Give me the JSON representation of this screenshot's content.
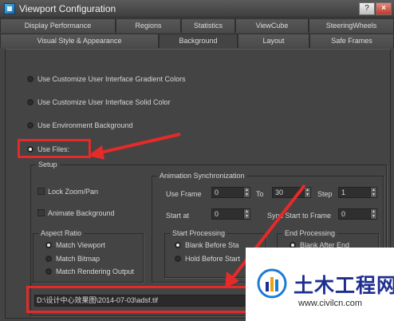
{
  "window": {
    "title": "Viewport Configuration",
    "help_label": "?",
    "close_label": "×"
  },
  "tabs_row1": [
    "Display Performance",
    "Regions",
    "Statistics",
    "ViewCube",
    "SteeringWheels"
  ],
  "tabs_row2": [
    "Visual Style & Appearance",
    "Background",
    "Layout",
    "Safe Frames"
  ],
  "active_tab": "Background",
  "background_options": [
    {
      "label": "Use Customize User Interface Gradient Colors",
      "selected": false
    },
    {
      "label": "Use Customize User Interface Solid Color",
      "selected": false
    },
    {
      "label": "Use Environment Background",
      "selected": false
    },
    {
      "label": "Use Files:",
      "selected": true
    }
  ],
  "setup": {
    "title": "Setup",
    "lock_zoom_pan": {
      "label": "Lock Zoom/Pan",
      "checked": false
    },
    "animate_background": {
      "label": "Animate Background",
      "checked": false
    },
    "aspect_ratio": {
      "title": "Aspect Ratio",
      "options": [
        {
          "label": "Match Viewport",
          "selected": true
        },
        {
          "label": "Match Bitmap",
          "selected": false
        },
        {
          "label": "Match Rendering Output",
          "selected": false
        }
      ]
    },
    "animation_sync": {
      "title": "Animation Synchronization",
      "use_frame_label": "Use Frame",
      "use_frame_value": "0",
      "to_label": "To",
      "to_value": "30",
      "step_label": "Step",
      "step_value": "1",
      "start_at_label": "Start at",
      "start_at_value": "0",
      "sync_start_label": "Sync Start to Frame",
      "sync_start_value": "0"
    },
    "start_processing": {
      "title": "Start Processing",
      "options": [
        {
          "label": "Blank Before Sta",
          "selected": true
        },
        {
          "label": "Hold Before Start",
          "selected": false
        }
      ]
    },
    "end_processing": {
      "title": "End Processing",
      "options": [
        {
          "label": "Blank After End",
          "selected": true
        }
      ]
    }
  },
  "file_path": "D:\\设计中心效果图\\2014-07-03\\adsf.tif",
  "watermark": {
    "title": "土木工程网",
    "url": "www.civilcn.com"
  },
  "colors": {
    "annotation": "#e52a2a",
    "window_bg": "#444444",
    "watermark_text": "#1d2e8f"
  }
}
